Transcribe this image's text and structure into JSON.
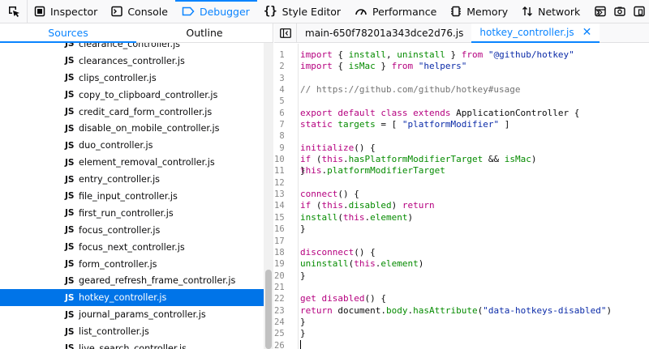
{
  "toolbar": {
    "tabs": [
      {
        "label": "Inspector",
        "icon": "inspector-icon"
      },
      {
        "label": "Console",
        "icon": "console-icon"
      },
      {
        "label": "Debugger",
        "icon": "debugger-icon",
        "selected": true
      },
      {
        "label": "Style Editor",
        "icon": "style-editor-icon"
      },
      {
        "label": "Performance",
        "icon": "performance-icon"
      },
      {
        "label": "Memory",
        "icon": "memory-icon"
      },
      {
        "label": "Network",
        "icon": "network-icon"
      }
    ]
  },
  "left_panel": {
    "tabs": [
      "Sources",
      "Outline"
    ],
    "file_badge": "JS",
    "files": [
      "clearance_controller.js",
      "clearances_controller.js",
      "clips_controller.js",
      "copy_to_clipboard_controller.js",
      "credit_card_form_controller.js",
      "disable_on_mobile_controller.js",
      "duo_controller.js",
      "element_removal_controller.js",
      "entry_controller.js",
      "file_input_controller.js",
      "first_run_controller.js",
      "focus_controller.js",
      "focus_next_controller.js",
      "form_controller.js",
      "geared_refresh_frame_controller.js",
      "hotkey_controller.js",
      "journal_params_controller.js",
      "list_controller.js",
      "live_search_controller.js"
    ],
    "selected_file": "hotkey_controller.js"
  },
  "editor": {
    "tabs": [
      {
        "label": "main-650f78201a343dce2d76.js",
        "active": false
      },
      {
        "label": "hotkey_controller.js",
        "active": true
      }
    ],
    "close_glyph": "✕",
    "line_count": 26
  },
  "colors": {
    "accent": "#0a84ff",
    "selection": "#0074e8",
    "keyword": "#b5007f",
    "string": "#0b2ba8",
    "function": "#058b00",
    "comment": "#737373"
  }
}
